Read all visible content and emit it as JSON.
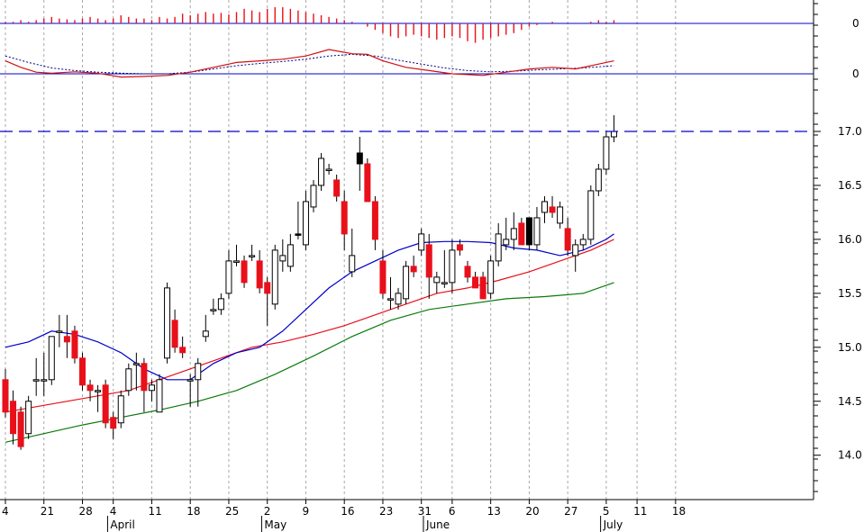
{
  "chart_data": {
    "type": "candlestick",
    "colors": {
      "background": "#ffffff",
      "up_body_fill": "#ffffff",
      "down_body_fill": "#e8101a",
      "highlight_body_fill": "#000000",
      "candle_outline": "#000000",
      "wick": "#000000",
      "grid": "#a8a8a8",
      "axis": "#000000",
      "separator": "#0000c8",
      "ma_short": "#0000c8",
      "ma_mid": "#e8101a",
      "ma_long": "#0b7a0b",
      "resistance": "#0000c8",
      "histogram": "#e8101a",
      "macd_line": "#d01010",
      "signal_line": "#000080"
    },
    "x_axis": {
      "ticks": [
        {
          "label": "4",
          "index": 0
        },
        {
          "label": "21",
          "index": 5
        },
        {
          "label": "28",
          "index": 10
        },
        {
          "label": "4",
          "index": 14
        },
        {
          "label": "11",
          "index": 19
        },
        {
          "label": "18",
          "index": 24
        },
        {
          "label": "25",
          "index": 29
        },
        {
          "label": "2",
          "index": 34
        },
        {
          "label": "9",
          "index": 39
        },
        {
          "label": "16",
          "index": 44
        },
        {
          "label": "23",
          "index": 49
        },
        {
          "label": "31",
          "index": 54
        },
        {
          "label": "6",
          "index": 58
        },
        {
          "label": "13",
          "index": 63
        },
        {
          "label": "20",
          "index": 68
        },
        {
          "label": "27",
          "index": 73
        },
        {
          "label": "5",
          "index": 78
        },
        {
          "label": "11",
          "index": 82
        },
        {
          "label": "18",
          "index": 87
        }
      ],
      "months": [
        {
          "label": "April",
          "index": 13.5
        },
        {
          "label": "May",
          "index": 33.5
        },
        {
          "label": "June",
          "index": 54.5
        },
        {
          "label": "July",
          "index": 77.5
        }
      ]
    },
    "price_axis": {
      "min": 13.86,
      "max": 17.0,
      "ticks": [
        14.0,
        14.5,
        15.0,
        15.5,
        16.0,
        16.5,
        17.0
      ],
      "tick_labels": [
        "14.0",
        "14.5",
        "15.0",
        "15.5",
        "16.0",
        "16.5",
        "17.0"
      ]
    },
    "resistance_level": 17.0,
    "candles": [
      {
        "o": 14.7,
        "h": 14.8,
        "l": 14.35,
        "c": 14.4
      },
      {
        "o": 14.5,
        "h": 14.6,
        "l": 14.1,
        "c": 14.2
      },
      {
        "o": 14.4,
        "h": 14.45,
        "l": 14.05,
        "c": 14.08
      },
      {
        "o": 14.2,
        "h": 14.55,
        "l": 14.15,
        "c": 14.5
      },
      {
        "o": 14.7,
        "h": 14.9,
        "l": 14.55,
        "c": 14.7
      },
      {
        "o": 14.7,
        "h": 14.95,
        "l": 14.55,
        "c": 14.7
      },
      {
        "o": 14.7,
        "h": 15.1,
        "l": 14.65,
        "c": 15.1
      },
      {
        "o": 15.15,
        "h": 15.3,
        "l": 15.0,
        "c": 15.15
      },
      {
        "o": 15.1,
        "h": 15.3,
        "l": 14.9,
        "c": 15.05
      },
      {
        "o": 15.15,
        "h": 15.2,
        "l": 14.85,
        "c": 14.9
      },
      {
        "o": 14.9,
        "h": 14.95,
        "l": 14.6,
        "c": 14.65
      },
      {
        "o": 14.65,
        "h": 14.7,
        "l": 14.5,
        "c": 14.6
      },
      {
        "o": 14.6,
        "h": 14.65,
        "l": 14.4,
        "c": 14.6
      },
      {
        "o": 14.65,
        "h": 14.7,
        "l": 14.25,
        "c": 14.3
      },
      {
        "o": 14.35,
        "h": 14.4,
        "l": 14.15,
        "c": 14.25
      },
      {
        "o": 14.3,
        "h": 14.6,
        "l": 14.25,
        "c": 14.55
      },
      {
        "o": 14.6,
        "h": 14.85,
        "l": 14.55,
        "c": 14.8
      },
      {
        "o": 14.85,
        "h": 14.95,
        "l": 14.6,
        "c": 14.85
      },
      {
        "o": 14.85,
        "h": 14.9,
        "l": 14.4,
        "c": 14.6
      },
      {
        "o": 14.6,
        "h": 14.7,
        "l": 14.5,
        "c": 14.65
      },
      {
        "o": 14.4,
        "h": 14.75,
        "l": 14.4,
        "c": 14.7
      },
      {
        "o": 14.9,
        "h": 15.6,
        "l": 14.85,
        "c": 15.55
      },
      {
        "o": 15.25,
        "h": 15.35,
        "l": 14.95,
        "c": 15.0
      },
      {
        "o": 15.0,
        "h": 15.1,
        "l": 14.9,
        "c": 14.95
      },
      {
        "o": 14.7,
        "h": 14.75,
        "l": 14.45,
        "c": 14.7
      },
      {
        "o": 14.7,
        "h": 14.9,
        "l": 14.45,
        "c": 14.85
      },
      {
        "o": 15.1,
        "h": 15.3,
        "l": 15.05,
        "c": 15.15
      },
      {
        "o": 15.35,
        "h": 15.45,
        "l": 15.3,
        "c": 15.35
      },
      {
        "o": 15.35,
        "h": 15.5,
        "l": 15.3,
        "c": 15.45
      },
      {
        "o": 15.5,
        "h": 15.9,
        "l": 15.45,
        "c": 15.8
      },
      {
        "o": 15.8,
        "h": 15.95,
        "l": 15.75,
        "c": 15.8
      },
      {
        "o": 15.8,
        "h": 15.85,
        "l": 15.55,
        "c": 15.6
      },
      {
        "o": 15.85,
        "h": 15.95,
        "l": 15.8,
        "c": 15.85
      },
      {
        "o": 15.8,
        "h": 15.9,
        "l": 15.5,
        "c": 15.55
      },
      {
        "o": 15.6,
        "h": 15.65,
        "l": 15.2,
        "c": 15.5
      },
      {
        "o": 15.4,
        "h": 15.95,
        "l": 15.35,
        "c": 15.9
      },
      {
        "o": 15.8,
        "h": 16.0,
        "l": 15.7,
        "c": 15.85
      },
      {
        "o": 15.75,
        "h": 16.05,
        "l": 15.7,
        "c": 15.95
      },
      {
        "o": 16.05,
        "h": 16.35,
        "l": 16.0,
        "c": 16.05,
        "highlight": true
      },
      {
        "o": 15.95,
        "h": 16.45,
        "l": 15.9,
        "c": 16.35
      },
      {
        "o": 16.3,
        "h": 16.55,
        "l": 16.25,
        "c": 16.5
      },
      {
        "o": 16.5,
        "h": 16.8,
        "l": 16.45,
        "c": 16.75
      },
      {
        "o": 16.65,
        "h": 16.7,
        "l": 16.6,
        "c": 16.65
      },
      {
        "o": 16.55,
        "h": 16.6,
        "l": 16.35,
        "c": 16.4
      },
      {
        "o": 16.35,
        "h": 16.45,
        "l": 15.9,
        "c": 16.05
      },
      {
        "o": 15.7,
        "h": 16.1,
        "l": 15.65,
        "c": 15.85
      },
      {
        "o": 16.8,
        "h": 16.95,
        "l": 16.45,
        "c": 16.7,
        "highlight": true
      },
      {
        "o": 16.7,
        "h": 16.75,
        "l": 16.4,
        "c": 16.35
      },
      {
        "o": 16.35,
        "h": 16.4,
        "l": 15.9,
        "c": 16.0
      },
      {
        "o": 15.8,
        "h": 15.9,
        "l": 15.45,
        "c": 15.5
      },
      {
        "o": 15.45,
        "h": 15.65,
        "l": 15.35,
        "c": 15.45
      },
      {
        "o": 15.4,
        "h": 15.55,
        "l": 15.35,
        "c": 15.5
      },
      {
        "o": 15.45,
        "h": 15.8,
        "l": 15.4,
        "c": 15.75
      },
      {
        "o": 15.75,
        "h": 15.85,
        "l": 15.65,
        "c": 15.7
      },
      {
        "o": 15.9,
        "h": 16.1,
        "l": 15.85,
        "c": 16.05
      },
      {
        "o": 15.95,
        "h": 16.05,
        "l": 15.45,
        "c": 15.65
      },
      {
        "o": 15.6,
        "h": 15.7,
        "l": 15.5,
        "c": 15.65
      },
      {
        "o": 15.6,
        "h": 15.9,
        "l": 15.55,
        "c": 15.6
      },
      {
        "o": 15.6,
        "h": 16.0,
        "l": 15.5,
        "c": 15.9
      },
      {
        "o": 15.95,
        "h": 16.0,
        "l": 15.85,
        "c": 15.9
      },
      {
        "o": 15.75,
        "h": 15.8,
        "l": 15.6,
        "c": 15.65
      },
      {
        "o": 15.65,
        "h": 15.7,
        "l": 15.55,
        "c": 15.55
      },
      {
        "o": 15.65,
        "h": 15.7,
        "l": 15.45,
        "c": 15.45
      },
      {
        "o": 15.5,
        "h": 15.85,
        "l": 15.45,
        "c": 15.8
      },
      {
        "o": 15.8,
        "h": 16.15,
        "l": 15.75,
        "c": 16.05
      },
      {
        "o": 15.95,
        "h": 16.2,
        "l": 15.9,
        "c": 16.0
      },
      {
        "o": 16.0,
        "h": 16.25,
        "l": 15.9,
        "c": 16.1
      },
      {
        "o": 16.15,
        "h": 16.2,
        "l": 15.95,
        "c": 15.95
      },
      {
        "o": 15.95,
        "h": 16.2,
        "l": 15.9,
        "c": 16.2,
        "highlight": true
      },
      {
        "o": 15.95,
        "h": 16.3,
        "l": 15.9,
        "c": 16.2
      },
      {
        "o": 16.25,
        "h": 16.4,
        "l": 16.15,
        "c": 16.35
      },
      {
        "o": 16.3,
        "h": 16.4,
        "l": 16.2,
        "c": 16.25
      },
      {
        "o": 16.15,
        "h": 16.35,
        "l": 16.1,
        "c": 16.3
      },
      {
        "o": 16.1,
        "h": 16.2,
        "l": 15.85,
        "c": 15.9
      },
      {
        "o": 15.85,
        "h": 16.0,
        "l": 15.7,
        "c": 15.95
      },
      {
        "o": 15.95,
        "h": 16.05,
        "l": 15.9,
        "c": 16.0
      },
      {
        "o": 16.0,
        "h": 16.5,
        "l": 15.95,
        "c": 16.45
      },
      {
        "o": 16.45,
        "h": 16.7,
        "l": 16.4,
        "c": 16.65
      },
      {
        "o": 16.65,
        "h": 17.0,
        "l": 16.6,
        "c": 16.95
      },
      {
        "o": 16.95,
        "h": 17.15,
        "l": 16.9,
        "c": 17.0
      }
    ],
    "ma_short": [
      {
        "i": 0,
        "v": 15.0
      },
      {
        "i": 3,
        "v": 15.05
      },
      {
        "i": 6,
        "v": 15.15
      },
      {
        "i": 9,
        "v": 15.12
      },
      {
        "i": 12,
        "v": 15.05
      },
      {
        "i": 15,
        "v": 14.95
      },
      {
        "i": 18,
        "v": 14.8
      },
      {
        "i": 21,
        "v": 14.7
      },
      {
        "i": 24,
        "v": 14.7
      },
      {
        "i": 27,
        "v": 14.85
      },
      {
        "i": 30,
        "v": 14.95
      },
      {
        "i": 33,
        "v": 15.0
      },
      {
        "i": 36,
        "v": 15.15
      },
      {
        "i": 39,
        "v": 15.35
      },
      {
        "i": 42,
        "v": 15.55
      },
      {
        "i": 45,
        "v": 15.7
      },
      {
        "i": 48,
        "v": 15.8
      },
      {
        "i": 51,
        "v": 15.9
      },
      {
        "i": 54,
        "v": 15.97
      },
      {
        "i": 57,
        "v": 15.98
      },
      {
        "i": 60,
        "v": 15.98
      },
      {
        "i": 63,
        "v": 15.97
      },
      {
        "i": 66,
        "v": 15.92
      },
      {
        "i": 69,
        "v": 15.9
      },
      {
        "i": 72,
        "v": 15.85
      },
      {
        "i": 75,
        "v": 15.9
      },
      {
        "i": 78,
        "v": 16.0
      },
      {
        "i": 79,
        "v": 16.05
      }
    ],
    "ma_mid": [
      {
        "i": 0,
        "v": 14.4
      },
      {
        "i": 4,
        "v": 14.45
      },
      {
        "i": 8,
        "v": 14.5
      },
      {
        "i": 12,
        "v": 14.55
      },
      {
        "i": 16,
        "v": 14.6
      },
      {
        "i": 20,
        "v": 14.7
      },
      {
        "i": 24,
        "v": 14.8
      },
      {
        "i": 28,
        "v": 14.9
      },
      {
        "i": 32,
        "v": 15.0
      },
      {
        "i": 36,
        "v": 15.05
      },
      {
        "i": 40,
        "v": 15.12
      },
      {
        "i": 44,
        "v": 15.2
      },
      {
        "i": 48,
        "v": 15.3
      },
      {
        "i": 52,
        "v": 15.4
      },
      {
        "i": 56,
        "v": 15.5
      },
      {
        "i": 60,
        "v": 15.55
      },
      {
        "i": 64,
        "v": 15.62
      },
      {
        "i": 68,
        "v": 15.7
      },
      {
        "i": 72,
        "v": 15.8
      },
      {
        "i": 76,
        "v": 15.9
      },
      {
        "i": 79,
        "v": 16.0
      }
    ],
    "ma_long": [
      {
        "i": 0,
        "v": 14.12
      },
      {
        "i": 5,
        "v": 14.2
      },
      {
        "i": 10,
        "v": 14.28
      },
      {
        "i": 15,
        "v": 14.35
      },
      {
        "i": 20,
        "v": 14.42
      },
      {
        "i": 25,
        "v": 14.5
      },
      {
        "i": 30,
        "v": 14.6
      },
      {
        "i": 35,
        "v": 14.75
      },
      {
        "i": 40,
        "v": 14.92
      },
      {
        "i": 45,
        "v": 15.1
      },
      {
        "i": 50,
        "v": 15.25
      },
      {
        "i": 55,
        "v": 15.35
      },
      {
        "i": 60,
        "v": 15.4
      },
      {
        "i": 65,
        "v": 15.45
      },
      {
        "i": 70,
        "v": 15.47
      },
      {
        "i": 75,
        "v": 15.5
      },
      {
        "i": 79,
        "v": 15.6
      }
    ],
    "histogram": {
      "zero_label": "0",
      "values": [
        0.1,
        0.1,
        0.2,
        0.1,
        0.2,
        0.3,
        0.4,
        0.3,
        0.25,
        0.2,
        0.3,
        0.4,
        0.3,
        0.2,
        0.3,
        0.5,
        0.4,
        0.3,
        0.3,
        0.2,
        0.4,
        0.3,
        0.4,
        0.6,
        0.5,
        0.6,
        0.7,
        0.6,
        0.65,
        0.55,
        0.7,
        0.9,
        0.8,
        0.7,
        0.9,
        1.0,
        1.0,
        0.9,
        0.8,
        0.7,
        0.6,
        0.5,
        0.4,
        0.3,
        0.2,
        0.1,
        0.0,
        -0.2,
        -0.4,
        -0.6,
        -0.8,
        -0.9,
        -0.8,
        -0.7,
        -0.8,
        -0.9,
        -1.0,
        -0.9,
        -0.8,
        -0.9,
        -1.1,
        -1.2,
        -1.0,
        -0.9,
        -0.8,
        -0.7,
        -0.6,
        -0.4,
        -0.2,
        -0.1,
        0.0,
        0.1,
        0.0,
        0.0,
        0.0,
        0.0,
        0.1,
        0.2,
        0.1,
        0.2
      ]
    },
    "oscillator": {
      "zero_label": "0",
      "macd": [
        {
          "i": 0,
          "v": 0.4
        },
        {
          "i": 2,
          "v": 0.2
        },
        {
          "i": 4,
          "v": 0.05
        },
        {
          "i": 6,
          "v": 0.02
        },
        {
          "i": 9,
          "v": 0.06
        },
        {
          "i": 12,
          "v": 0.02
        },
        {
          "i": 15,
          "v": -0.1
        },
        {
          "i": 18,
          "v": -0.08
        },
        {
          "i": 21,
          "v": -0.05
        },
        {
          "i": 24,
          "v": 0.05
        },
        {
          "i": 27,
          "v": 0.2
        },
        {
          "i": 30,
          "v": 0.35
        },
        {
          "i": 33,
          "v": 0.4
        },
        {
          "i": 36,
          "v": 0.45
        },
        {
          "i": 39,
          "v": 0.55
        },
        {
          "i": 42,
          "v": 0.75
        },
        {
          "i": 45,
          "v": 0.62
        },
        {
          "i": 47,
          "v": 0.6
        },
        {
          "i": 49,
          "v": 0.4
        },
        {
          "i": 52,
          "v": 0.2
        },
        {
          "i": 55,
          "v": 0.1
        },
        {
          "i": 58,
          "v": 0.0
        },
        {
          "i": 62,
          "v": -0.05
        },
        {
          "i": 65,
          "v": 0.05
        },
        {
          "i": 68,
          "v": 0.15
        },
        {
          "i": 71,
          "v": 0.2
        },
        {
          "i": 74,
          "v": 0.15
        },
        {
          "i": 77,
          "v": 0.3
        },
        {
          "i": 79,
          "v": 0.4
        }
      ],
      "signal": [
        {
          "i": 0,
          "v": 0.55
        },
        {
          "i": 3,
          "v": 0.35
        },
        {
          "i": 6,
          "v": 0.18
        },
        {
          "i": 9,
          "v": 0.1
        },
        {
          "i": 12,
          "v": 0.05
        },
        {
          "i": 15,
          "v": 0.02
        },
        {
          "i": 18,
          "v": 0.0
        },
        {
          "i": 21,
          "v": 0.0
        },
        {
          "i": 24,
          "v": 0.05
        },
        {
          "i": 27,
          "v": 0.15
        },
        {
          "i": 30,
          "v": 0.25
        },
        {
          "i": 33,
          "v": 0.32
        },
        {
          "i": 36,
          "v": 0.38
        },
        {
          "i": 39,
          "v": 0.45
        },
        {
          "i": 42,
          "v": 0.55
        },
        {
          "i": 45,
          "v": 0.6
        },
        {
          "i": 48,
          "v": 0.55
        },
        {
          "i": 51,
          "v": 0.42
        },
        {
          "i": 54,
          "v": 0.3
        },
        {
          "i": 57,
          "v": 0.18
        },
        {
          "i": 60,
          "v": 0.1
        },
        {
          "i": 63,
          "v": 0.06
        },
        {
          "i": 66,
          "v": 0.08
        },
        {
          "i": 69,
          "v": 0.12
        },
        {
          "i": 72,
          "v": 0.15
        },
        {
          "i": 75,
          "v": 0.18
        },
        {
          "i": 79,
          "v": 0.25
        }
      ]
    }
  }
}
